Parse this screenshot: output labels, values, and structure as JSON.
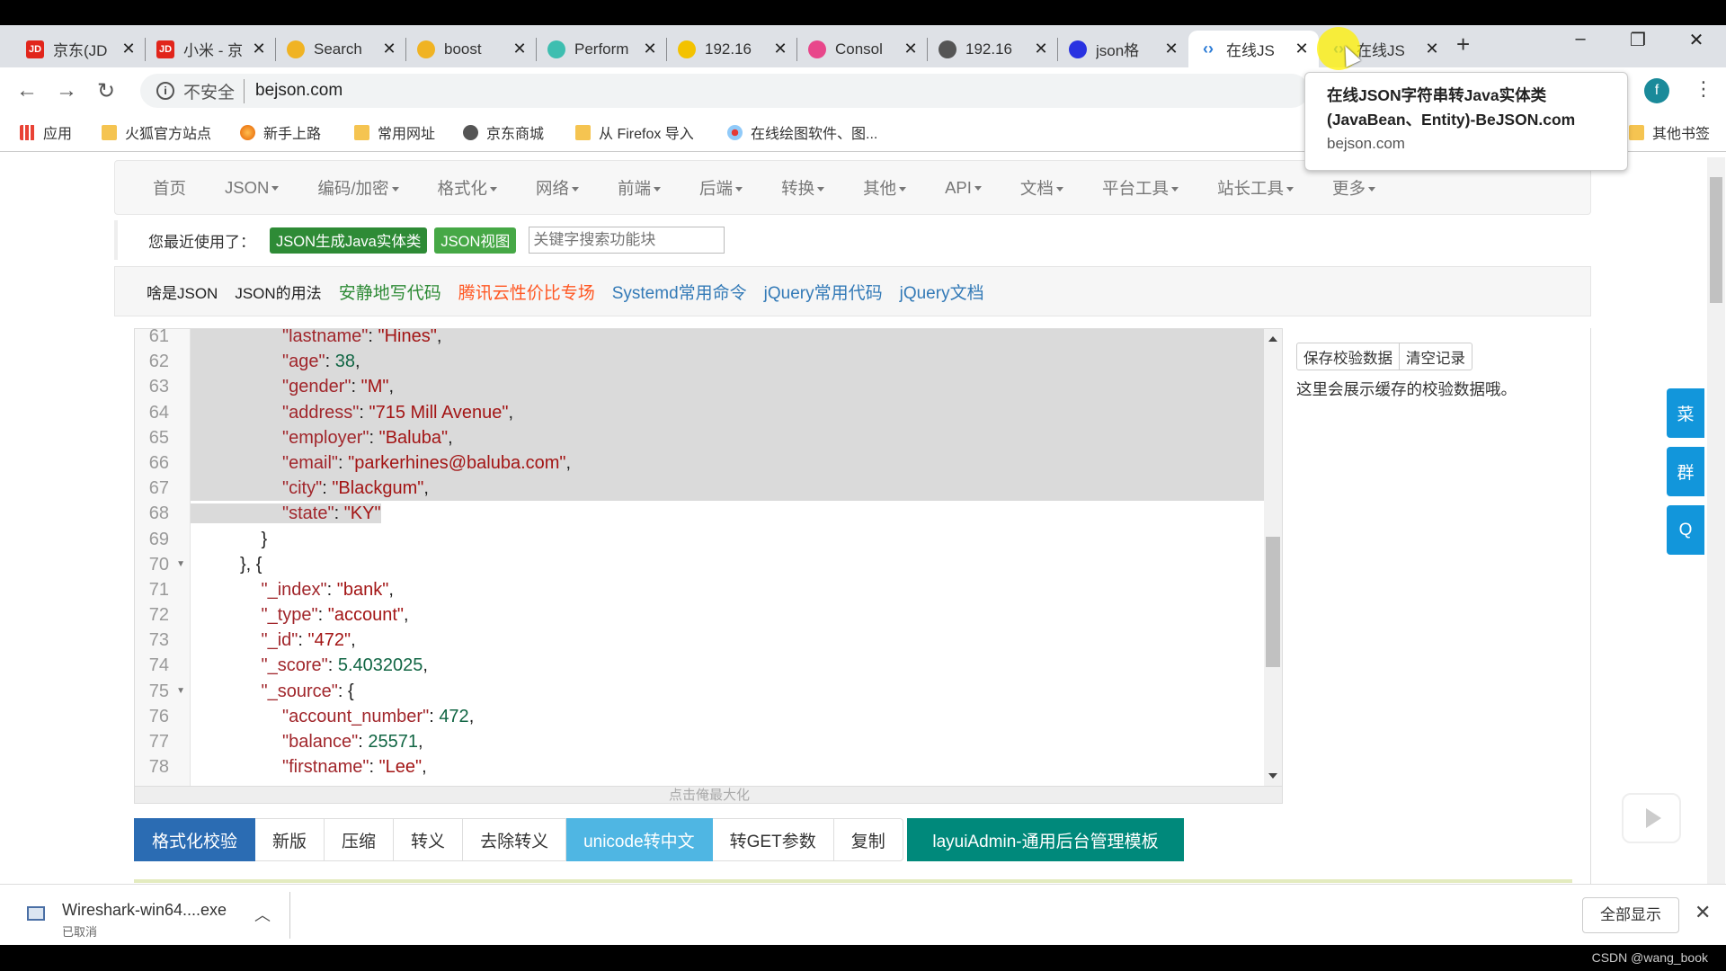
{
  "browser": {
    "tabs": [
      {
        "label": "京东(JD",
        "icon": "jd-icon",
        "color": "#e1251b",
        "glyph": "JD"
      },
      {
        "label": "小米 - 京",
        "icon": "jd-icon",
        "color": "#e1251b",
        "glyph": "JD"
      },
      {
        "label": "Search",
        "icon": "elastic-icon",
        "color": "#f0b323",
        "glyph": ""
      },
      {
        "label": "boost",
        "icon": "elastic-icon",
        "color": "#f0b323",
        "glyph": ""
      },
      {
        "label": "Perform",
        "icon": "elastic-icon",
        "color": "#3ebeb0",
        "glyph": ""
      },
      {
        "label": "192.16",
        "icon": "elasticsearch-icon",
        "color": "#f3c200",
        "glyph": ""
      },
      {
        "label": "Consol",
        "icon": "kibana-icon",
        "color": "#e8478b",
        "glyph": ""
      },
      {
        "label": "192.16",
        "icon": "globe-icon",
        "color": "#555555",
        "glyph": ""
      },
      {
        "label": "json格",
        "icon": "baidu-paw-icon",
        "color": "#2932e1",
        "glyph": ""
      },
      {
        "label": "在线JS",
        "icon": "code-brackets-icon",
        "color": "#2b7bd6",
        "glyph": "‹›"
      },
      {
        "label": "在线JS",
        "icon": "code-brackets-icon",
        "color": "#2b7bd6",
        "glyph": "‹›"
      }
    ],
    "active_tab": 9,
    "new_tab": "+",
    "window_controls": {
      "minimize": "–",
      "restore": "❐",
      "close": "✕"
    },
    "security_label": "不安全",
    "url": "bejson.com",
    "profile_initial": "f",
    "bookmarks": [
      {
        "label": "应用",
        "icon": "apps-grid-icon"
      },
      {
        "label": "火狐官方站点",
        "icon": "folder-icon"
      },
      {
        "label": "新手上路",
        "icon": "firefox-icon"
      },
      {
        "label": "常用网址",
        "icon": "folder-icon"
      },
      {
        "label": "京东商城",
        "icon": "globe-icon"
      },
      {
        "label": "从 Firefox 导入",
        "icon": "folder-icon"
      },
      {
        "label": "在线绘图软件、图...",
        "icon": "drawio-icon"
      }
    ],
    "other_bookmarks": "其他书签",
    "tooltip": {
      "title": "在线JSON字符串转Java实体类(JavaBean、Entity)-BeJSON.com",
      "url": "bejson.com"
    }
  },
  "nav": [
    "首页",
    "JSON",
    "编码/加密",
    "格式化",
    "网络",
    "前端",
    "后端",
    "转换",
    "其他",
    "API",
    "文档",
    "平台工具",
    "站长工具",
    "更多"
  ],
  "recent": {
    "label": "您最近使用了：",
    "items": [
      {
        "label": "JSON生成Java实体类",
        "color": "#2e8b36"
      },
      {
        "label": "JSON视图",
        "color": "#46a846"
      }
    ],
    "search_placeholder": "关键字搜索功能块"
  },
  "links": [
    {
      "label": "啥是JSON",
      "color": "#222222"
    },
    {
      "label": "JSON的用法",
      "color": "#222222"
    },
    {
      "label": "安静地写代码",
      "color": "#2e8b36"
    },
    {
      "label": "腾讯云性价比专场",
      "color": "#ff5722"
    },
    {
      "label": "Systemd常用命令",
      "color": "#337ab7"
    },
    {
      "label": "jQuery常用代码",
      "color": "#337ab7"
    },
    {
      "label": "jQuery文档",
      "color": "#337ab7"
    }
  ],
  "editor": {
    "selection": {
      "from_line": 61,
      "to_line": 68
    },
    "lines": [
      {
        "n": 61,
        "indent": 4,
        "tokens": [
          {
            "t": "\"lastname\"",
            "k": "key"
          },
          {
            "t": ": ",
            "k": "p"
          },
          {
            "t": "\"Hines\"",
            "k": "str"
          },
          {
            "t": ",",
            "k": "p"
          }
        ]
      },
      {
        "n": 62,
        "indent": 4,
        "tokens": [
          {
            "t": "\"age\"",
            "k": "key"
          },
          {
            "t": ": ",
            "k": "p"
          },
          {
            "t": "38",
            "k": "num"
          },
          {
            "t": ",",
            "k": "p"
          }
        ]
      },
      {
        "n": 63,
        "indent": 4,
        "tokens": [
          {
            "t": "\"gender\"",
            "k": "key"
          },
          {
            "t": ": ",
            "k": "p"
          },
          {
            "t": "\"M\"",
            "k": "str"
          },
          {
            "t": ",",
            "k": "p"
          }
        ]
      },
      {
        "n": 64,
        "indent": 4,
        "tokens": [
          {
            "t": "\"address\"",
            "k": "key"
          },
          {
            "t": ": ",
            "k": "p"
          },
          {
            "t": "\"715 Mill Avenue\"",
            "k": "str"
          },
          {
            "t": ",",
            "k": "p"
          }
        ]
      },
      {
        "n": 65,
        "indent": 4,
        "tokens": [
          {
            "t": "\"employer\"",
            "k": "key"
          },
          {
            "t": ": ",
            "k": "p"
          },
          {
            "t": "\"Baluba\"",
            "k": "str"
          },
          {
            "t": ",",
            "k": "p"
          }
        ]
      },
      {
        "n": 66,
        "indent": 4,
        "tokens": [
          {
            "t": "\"email\"",
            "k": "key"
          },
          {
            "t": ": ",
            "k": "p"
          },
          {
            "t": "\"parkerhines@baluba.com\"",
            "k": "str"
          },
          {
            "t": ",",
            "k": "p"
          }
        ]
      },
      {
        "n": 67,
        "indent": 4,
        "tokens": [
          {
            "t": "\"city\"",
            "k": "key"
          },
          {
            "t": ": ",
            "k": "p"
          },
          {
            "t": "\"Blackgum\"",
            "k": "str"
          },
          {
            "t": ",",
            "k": "p"
          }
        ]
      },
      {
        "n": 68,
        "indent": 4,
        "tokens": [
          {
            "t": "\"state\"",
            "k": "key"
          },
          {
            "t": ": ",
            "k": "p"
          },
          {
            "t": "\"KY\"",
            "k": "str"
          }
        ]
      },
      {
        "n": 69,
        "indent": 3,
        "tokens": [
          {
            "t": "}",
            "k": "p"
          }
        ]
      },
      {
        "n": 70,
        "indent": 2,
        "fold": true,
        "tokens": [
          {
            "t": "}, {",
            "k": "p"
          }
        ]
      },
      {
        "n": 71,
        "indent": 3,
        "tokens": [
          {
            "t": "\"_index\"",
            "k": "key"
          },
          {
            "t": ": ",
            "k": "p"
          },
          {
            "t": "\"bank\"",
            "k": "str"
          },
          {
            "t": ",",
            "k": "p"
          }
        ]
      },
      {
        "n": 72,
        "indent": 3,
        "tokens": [
          {
            "t": "\"_type\"",
            "k": "key"
          },
          {
            "t": ": ",
            "k": "p"
          },
          {
            "t": "\"account\"",
            "k": "str"
          },
          {
            "t": ",",
            "k": "p"
          }
        ]
      },
      {
        "n": 73,
        "indent": 3,
        "tokens": [
          {
            "t": "\"_id\"",
            "k": "key"
          },
          {
            "t": ": ",
            "k": "p"
          },
          {
            "t": "\"472\"",
            "k": "str"
          },
          {
            "t": ",",
            "k": "p"
          }
        ]
      },
      {
        "n": 74,
        "indent": 3,
        "tokens": [
          {
            "t": "\"_score\"",
            "k": "key"
          },
          {
            "t": ": ",
            "k": "p"
          },
          {
            "t": "5.4032025",
            "k": "num"
          },
          {
            "t": ",",
            "k": "p"
          }
        ]
      },
      {
        "n": 75,
        "indent": 3,
        "fold": true,
        "tokens": [
          {
            "t": "\"_source\"",
            "k": "key"
          },
          {
            "t": ": {",
            "k": "p"
          }
        ]
      },
      {
        "n": 76,
        "indent": 4,
        "tokens": [
          {
            "t": "\"account_number\"",
            "k": "key"
          },
          {
            "t": ": ",
            "k": "p"
          },
          {
            "t": "472",
            "k": "num"
          },
          {
            "t": ",",
            "k": "p"
          }
        ]
      },
      {
        "n": 77,
        "indent": 4,
        "tokens": [
          {
            "t": "\"balance\"",
            "k": "key"
          },
          {
            "t": ": ",
            "k": "p"
          },
          {
            "t": "25571",
            "k": "num"
          },
          {
            "t": ",",
            "k": "p"
          }
        ]
      },
      {
        "n": 78,
        "indent": 4,
        "tokens": [
          {
            "t": "\"firstname\"",
            "k": "key"
          },
          {
            "t": ": ",
            "k": "p"
          },
          {
            "t": "\"Lee\"",
            "k": "str"
          },
          {
            "t": ",",
            "k": "p"
          }
        ]
      }
    ],
    "maximize_label": "点击俺最大化"
  },
  "right_panel": {
    "save_label": "保存校验数据",
    "clear_label": "清空记录",
    "note": "这里会展示缓存的校验数据哦。"
  },
  "side_buttons": [
    "菜",
    "群",
    "Q"
  ],
  "actions": [
    {
      "label": "格式化校验",
      "bg": "#2b6cb3",
      "fg": "#ffffff"
    },
    {
      "label": "新版",
      "bg": "#ffffff",
      "fg": "#333333"
    },
    {
      "label": "压缩",
      "bg": "#ffffff",
      "fg": "#333333"
    },
    {
      "label": "转义",
      "bg": "#ffffff",
      "fg": "#333333"
    },
    {
      "label": "去除转义",
      "bg": "#ffffff",
      "fg": "#333333"
    },
    {
      "label": "unicode转中文",
      "bg": "#4fb6e3",
      "fg": "#ffffff"
    },
    {
      "label": "转GET参数",
      "bg": "#ffffff",
      "fg": "#333333"
    },
    {
      "label": "复制",
      "bg": "#ffffff",
      "fg": "#333333"
    }
  ],
  "layui_button": {
    "label": "layuiAdmin-通用后台管理模板",
    "bg": "#00897b"
  },
  "download": {
    "filename": "Wireshark-win64....exe",
    "status": "已取消",
    "show_all": "全部显示"
  },
  "watermark": "CSDN @wang_book"
}
